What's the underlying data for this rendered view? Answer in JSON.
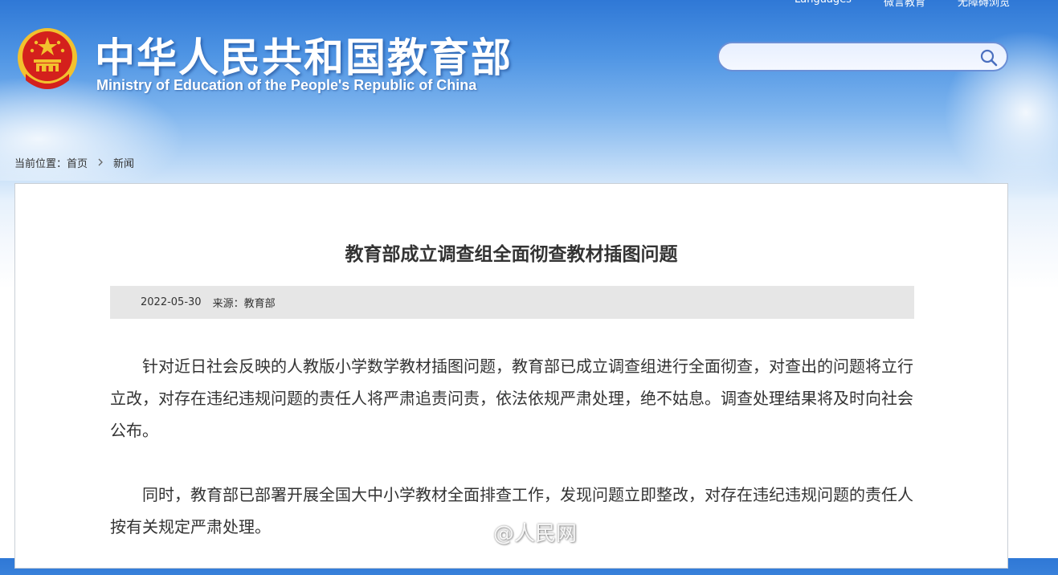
{
  "header": {
    "title_cn": "中华人民共和国教育部",
    "title_en": "Ministry of Education of the People's Republic of China",
    "links": [
      "Languages",
      "微言教育",
      "无障碍浏览"
    ]
  },
  "search": {
    "placeholder": "",
    "value": ""
  },
  "breadcrumb": {
    "prefix": "当前位置：",
    "home": "首页",
    "current": "新闻"
  },
  "article": {
    "title": "教育部成立调查组全面彻查教材插图问题",
    "date": "2022-05-30",
    "source": "来源：教育部",
    "paragraphs": [
      "针对近日社会反映的人教版小学数学教材插图问题，教育部已成立调查组进行全面彻查，对查出的问题将立行立改，对存在违纪违规问题的责任人将严肃追责问责，依法依规严肃处理，绝不姑息。调查处理结果将及时向社会公布。",
      "同时，教育部已部署开展全国大中小学教材全面排查工作，发现问题立即整改，对存在违纪违规问题的责任人按有关规定严肃处理。"
    ]
  },
  "watermark": {
    "text": "@人民网"
  },
  "colors": {
    "header_top": "#2f78d6",
    "panel_border": "#c9cfd6",
    "meta_bg": "#e6e6e6",
    "text": "#333333",
    "emblem_red": "#d4201c",
    "emblem_gold": "#f2c12e"
  },
  "icons": [
    "national-emblem-icon",
    "search-icon",
    "chevron-right-icon",
    "weibo-icon"
  ]
}
